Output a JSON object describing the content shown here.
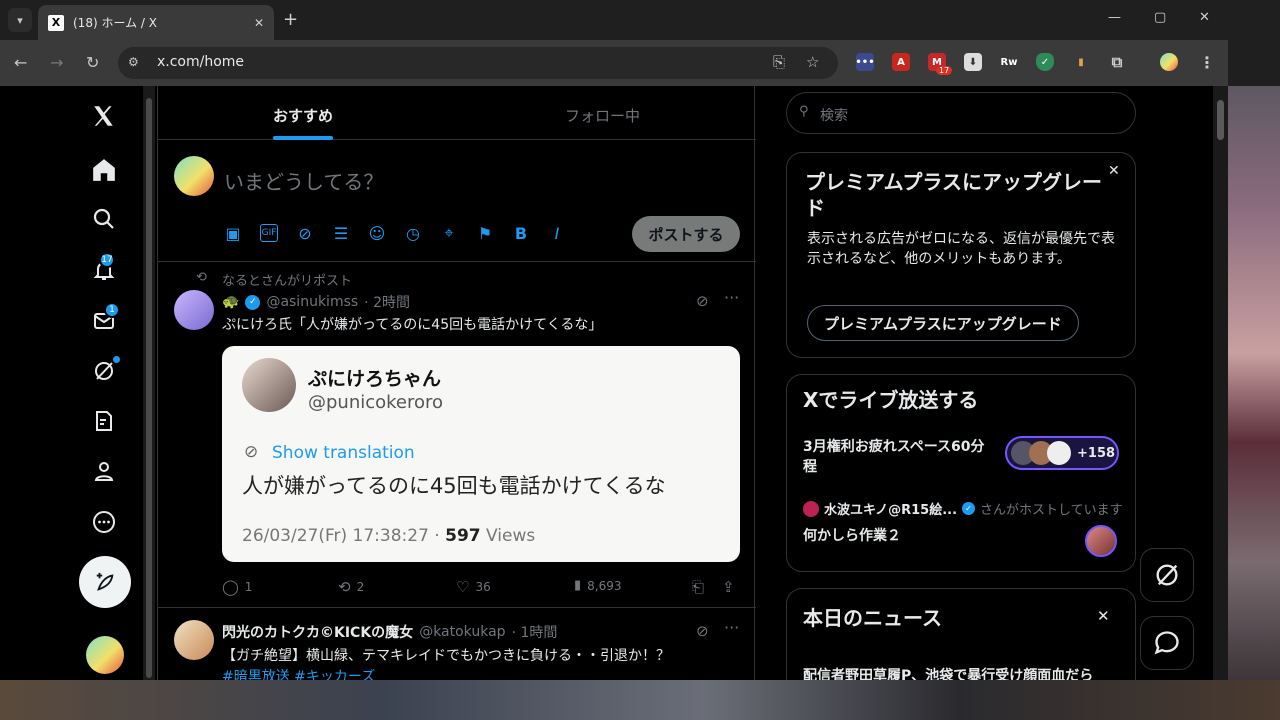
{
  "browser": {
    "tab_title": "(18) ホーム / X",
    "url": "x.com/home",
    "ext_badge": "17"
  },
  "nav": {
    "notifications_badge": "17",
    "messages_badge": "1"
  },
  "feed_tabs": {
    "recommended": "おすすめ",
    "following": "フォロー中"
  },
  "composer": {
    "placeholder": "いまどうしてる？",
    "post_label": "ポストする"
  },
  "tweet1": {
    "repost_line": "なるとさんがリポスト",
    "name_emoji": "🐢",
    "handle": "@asinukimss",
    "time": "· 2時間",
    "text": "ぷにけろ氏「人が嫌がってるのに45回も電話かけてくるな」",
    "embed": {
      "name": "ぷにけろちゃん",
      "handle": "@punicokeroro",
      "translate": "Show translation",
      "body": "人が嫌がってるのに45回も電話かけてくるな",
      "date": "26/03/27(Fr) 17:38:27 · ",
      "views_num": "597",
      "views_label": " Views"
    },
    "replies": "1",
    "reposts": "2",
    "likes": "36",
    "views": "8,693"
  },
  "tweet2": {
    "name": "閃光のカトクカ©KICKの魔女",
    "handle": "@katokukap",
    "time": "· 1時間",
    "text": "【ガチ絶望】横山緑、テマキレイドでもかつきに負ける・・引退か！？",
    "hashtags": "#暗黒放送 #キッカーズ"
  },
  "search": {
    "placeholder": "検索"
  },
  "premium": {
    "title": "プレミアムプラスにアップグレード",
    "body": "表示される広告がゼロになる、返信が最優先で表示されるなど、他のメリットもあります。",
    "button": "プレミアムプラスにアップグレード"
  },
  "live": {
    "title": "Xでライブ放送する",
    "space1_title": "3月権利お疲れスペース60分程",
    "space1_count": "+158",
    "host_name": "水波ユキノ@R15絵...",
    "host_suffix": "さんがホストしています",
    "space2_title": "何かしら作業２"
  },
  "news": {
    "title": "本日のニュース",
    "item1": "配信者野田草履P、池袋で暴行受け顔面血だら"
  },
  "colors": {
    "accent": "#1d9bf0",
    "bg": "#000000",
    "text": "#e7e9ea",
    "muted": "#71767b"
  }
}
